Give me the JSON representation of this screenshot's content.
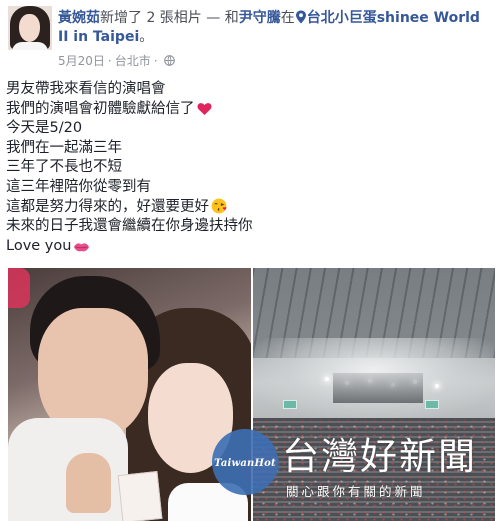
{
  "post": {
    "author": "黃婉茹",
    "action": "新增了 2 張相片 — 和",
    "tagged_friend": "尹守騰",
    "at_word": "在",
    "place": "台北小巨蛋shinee World II in Taipei",
    "suffix": "。",
    "date": "5月20日",
    "separator": "·",
    "location": "台北市",
    "separator2": "·",
    "audience_icon": "globe-icon",
    "place_icon": "map-pin-icon",
    "place_icon_color": "#365899",
    "lines": [
      "男友帶我來看信的演唱會",
      "我們的演唱會初體驗獻給信了",
      "今天是5/20",
      "我們在一起滿三年",
      "三年了不長也不短",
      "這三年裡陪你從零到有",
      "這都是努力得來的，好還要更好",
      "未來的日子我還會繼續在你身邊扶持你",
      "Love you"
    ],
    "emojis": {
      "line2": "red-heart-emoji",
      "line7": "kissing-face-emoji",
      "line9": "kiss-lips-emoji"
    },
    "colors": {
      "link": "#365899",
      "meta": "#90949c",
      "text": "#1d2129",
      "heart": "#e0245e"
    }
  },
  "photos": [
    {
      "name": "couple-selfie-photo"
    },
    {
      "name": "concert-arena-photo"
    }
  ],
  "watermark": {
    "badge": "TaiwanHot",
    "title": "台灣好新聞",
    "tagline": "關心跟你有關的新聞",
    "color": "#3d6fb5"
  }
}
